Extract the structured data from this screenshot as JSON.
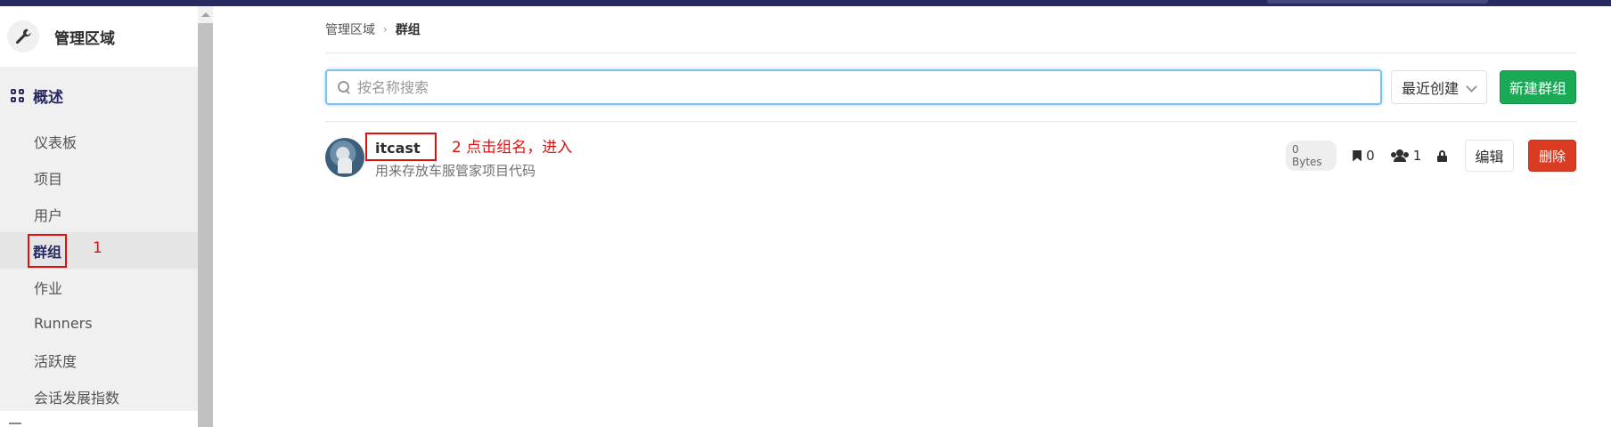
{
  "sidebar": {
    "title": "管理区域",
    "section_label": "概述",
    "items": [
      {
        "label": "仪表板"
      },
      {
        "label": "项目"
      },
      {
        "label": "用户"
      },
      {
        "label": "群组"
      },
      {
        "label": "作业"
      },
      {
        "label": "Runners"
      },
      {
        "label": "活跃度"
      },
      {
        "label": "会话发展指数"
      }
    ],
    "active_index": 3
  },
  "annotations": {
    "step1": "1",
    "step2": "2 点击组名，进入"
  },
  "breadcrumb": {
    "parent": "管理区域",
    "separator": "›",
    "current": "群组"
  },
  "search": {
    "placeholder": "按名称搜索",
    "value": ""
  },
  "sort": {
    "selected": "最近创建"
  },
  "new_group_button": "新建群组",
  "groups": [
    {
      "name": "itcast",
      "description": "用来存放车服管家项目代码",
      "size": "0 Bytes",
      "projects": "0",
      "members": "1",
      "visibility": "private",
      "edit_label": "编辑",
      "delete_label": "删除"
    }
  ],
  "colors": {
    "primary": "#292961",
    "success": "#1aaa55",
    "danger": "#db3b21",
    "annotation": "#e01010"
  },
  "icons": {
    "admin": "wrench-icon",
    "overview": "grid-icon",
    "search": "search-icon",
    "projects": "bookmark-icon",
    "members": "users-icon",
    "visibility": "lock-icon"
  }
}
